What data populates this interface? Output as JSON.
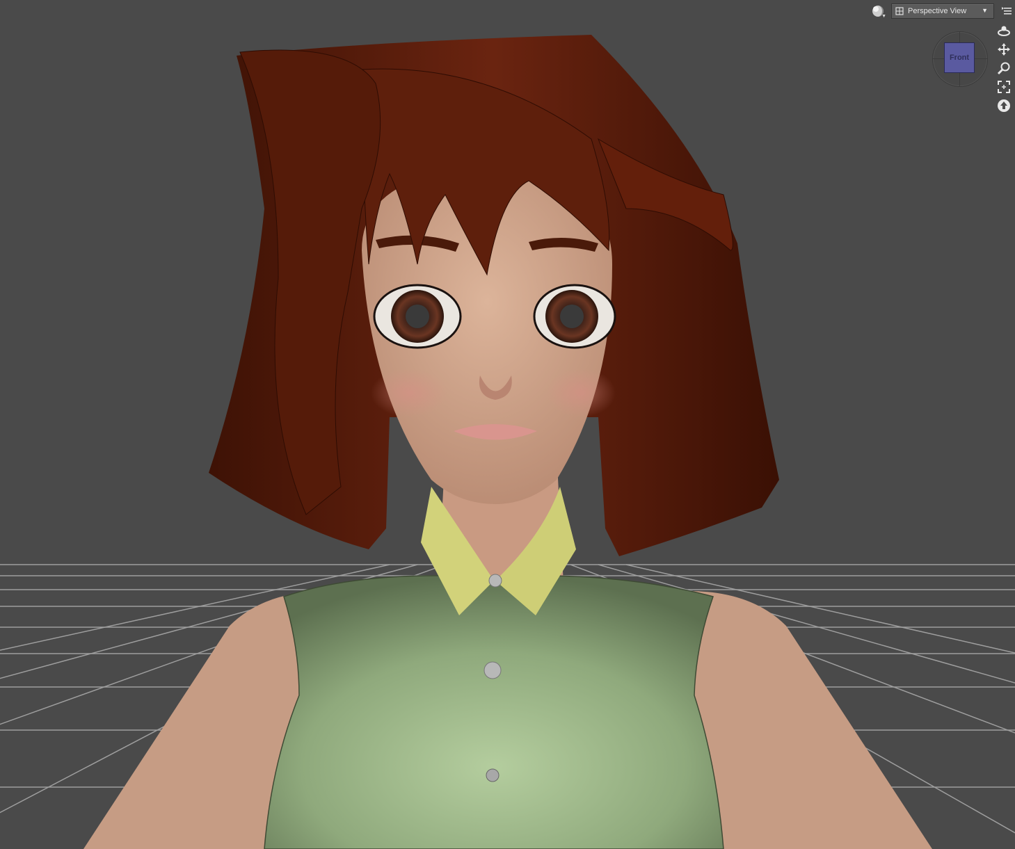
{
  "viewport": {
    "view_label": "Perspective View",
    "dropdown_arrow": "▼",
    "cube_label": "Front",
    "icons": {
      "shading": "sphere-shading-icon",
      "view": "camera-view-icon",
      "menu": "list-menu-icon",
      "tools": [
        "orbit-icon",
        "pan-icon",
        "zoom-icon",
        "frame-icon",
        "reset-view-icon"
      ]
    }
  },
  "scene": {
    "background": "#4a4a4a",
    "grid_color": "#9a9a9a",
    "hair_color": "#5a1d0b",
    "skin_color": "#d4a88e",
    "shirt_color": "#a8c495",
    "collar_color": "#d6d67a",
    "iris_color": "#5a2d1c"
  }
}
